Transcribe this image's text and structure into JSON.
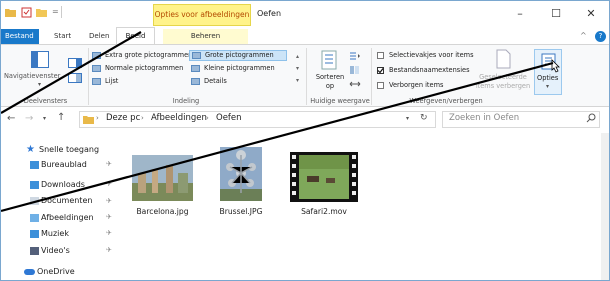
{
  "titlebar": {
    "context_tab": "Opties voor afbeeldingen",
    "title": "Oefen",
    "minimize": "–",
    "maximize": "☐",
    "close": "✕"
  },
  "tabs": {
    "file": "Bestand",
    "start": "Start",
    "share": "Delen",
    "view": "Beeld",
    "manage": "Beheren",
    "collapse": "^",
    "help": "?"
  },
  "ribbon": {
    "nav_pane": "Navigatievenster",
    "layout_items": [
      "Extra grote pictogrammen",
      "Grote pictogrammen",
      "Normale pictogrammen",
      "Kleine pictogrammen",
      "Lijst",
      "Details"
    ],
    "sort": "Sorteren\nop",
    "checkboxes": [
      {
        "label": "Selectievakjes voor items",
        "checked": false
      },
      {
        "label": "Bestandsnaamextensies",
        "checked": true
      },
      {
        "label": "Verborgen items",
        "checked": false
      }
    ],
    "hide_selected": "Geselecteerde\nitems verbergen",
    "options": "Opties",
    "groups": {
      "panes": "Deelvensters",
      "layout": "Indeling",
      "current_view": "Huidige weergave",
      "show_hide": "Weergeven/verbergen"
    }
  },
  "address": {
    "path": [
      "Deze pc",
      "Afbeeldingen",
      "Oefen"
    ],
    "search_placeholder": "Zoeken in Oefen"
  },
  "nav": {
    "quick_access": "Snelle toegang",
    "items": [
      "Bureaublad",
      "Downloads",
      "Documenten",
      "Afbeeldingen",
      "Muziek",
      "Video's"
    ],
    "onedrive": "OneDrive"
  },
  "files": [
    {
      "name": "Barcelona.jpg"
    },
    {
      "name": "Brussel.JPG"
    },
    {
      "name": "Safari2.mov"
    }
  ],
  "colors": {
    "accent": "#1979ca",
    "context_tab": "#fff38a"
  }
}
